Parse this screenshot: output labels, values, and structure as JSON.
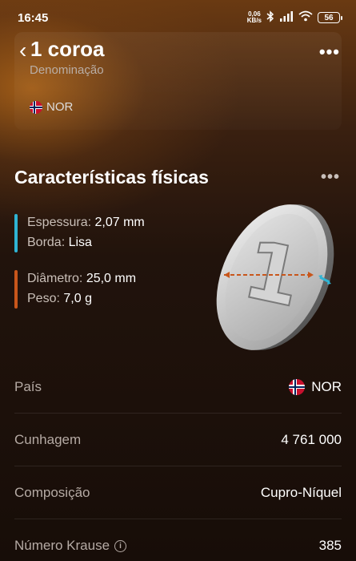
{
  "status_bar": {
    "time": "16:45",
    "net_speed_value": "0,06",
    "net_speed_unit": "KB/s",
    "battery": "56"
  },
  "header": {
    "title": "1 coroa",
    "subtitle": "Denominação",
    "country": "NOR",
    "back_icon": "chevron-left-icon",
    "more_icon": "more-horizontal-icon"
  },
  "section": {
    "title": "Características físicas"
  },
  "specs": {
    "group1": {
      "color": "#2fb4d4",
      "thickness_label": "Espessura:",
      "thickness_value": "2,07 mm",
      "edge_label": "Borda:",
      "edge_value": "Lisa"
    },
    "group2": {
      "color": "#c8561b",
      "diameter_label": "Diâmetro:",
      "diameter_value": "25,0 mm",
      "weight_label": "Peso:",
      "weight_value": "7,0 g"
    }
  },
  "coin": {
    "numeral": "1"
  },
  "rows": [
    {
      "label": "País",
      "value": "NOR"
    },
    {
      "label": "Cunhagem",
      "value": "4 761 000"
    },
    {
      "label": "Composição",
      "value": "Cupro-Níquel"
    },
    {
      "label": "Número Krause",
      "value": "385"
    }
  ],
  "colors": {
    "accent_orange": "#c8561b",
    "accent_cyan": "#2fb4d4",
    "flag_red": "#c8102e",
    "flag_blue": "#00205b"
  }
}
